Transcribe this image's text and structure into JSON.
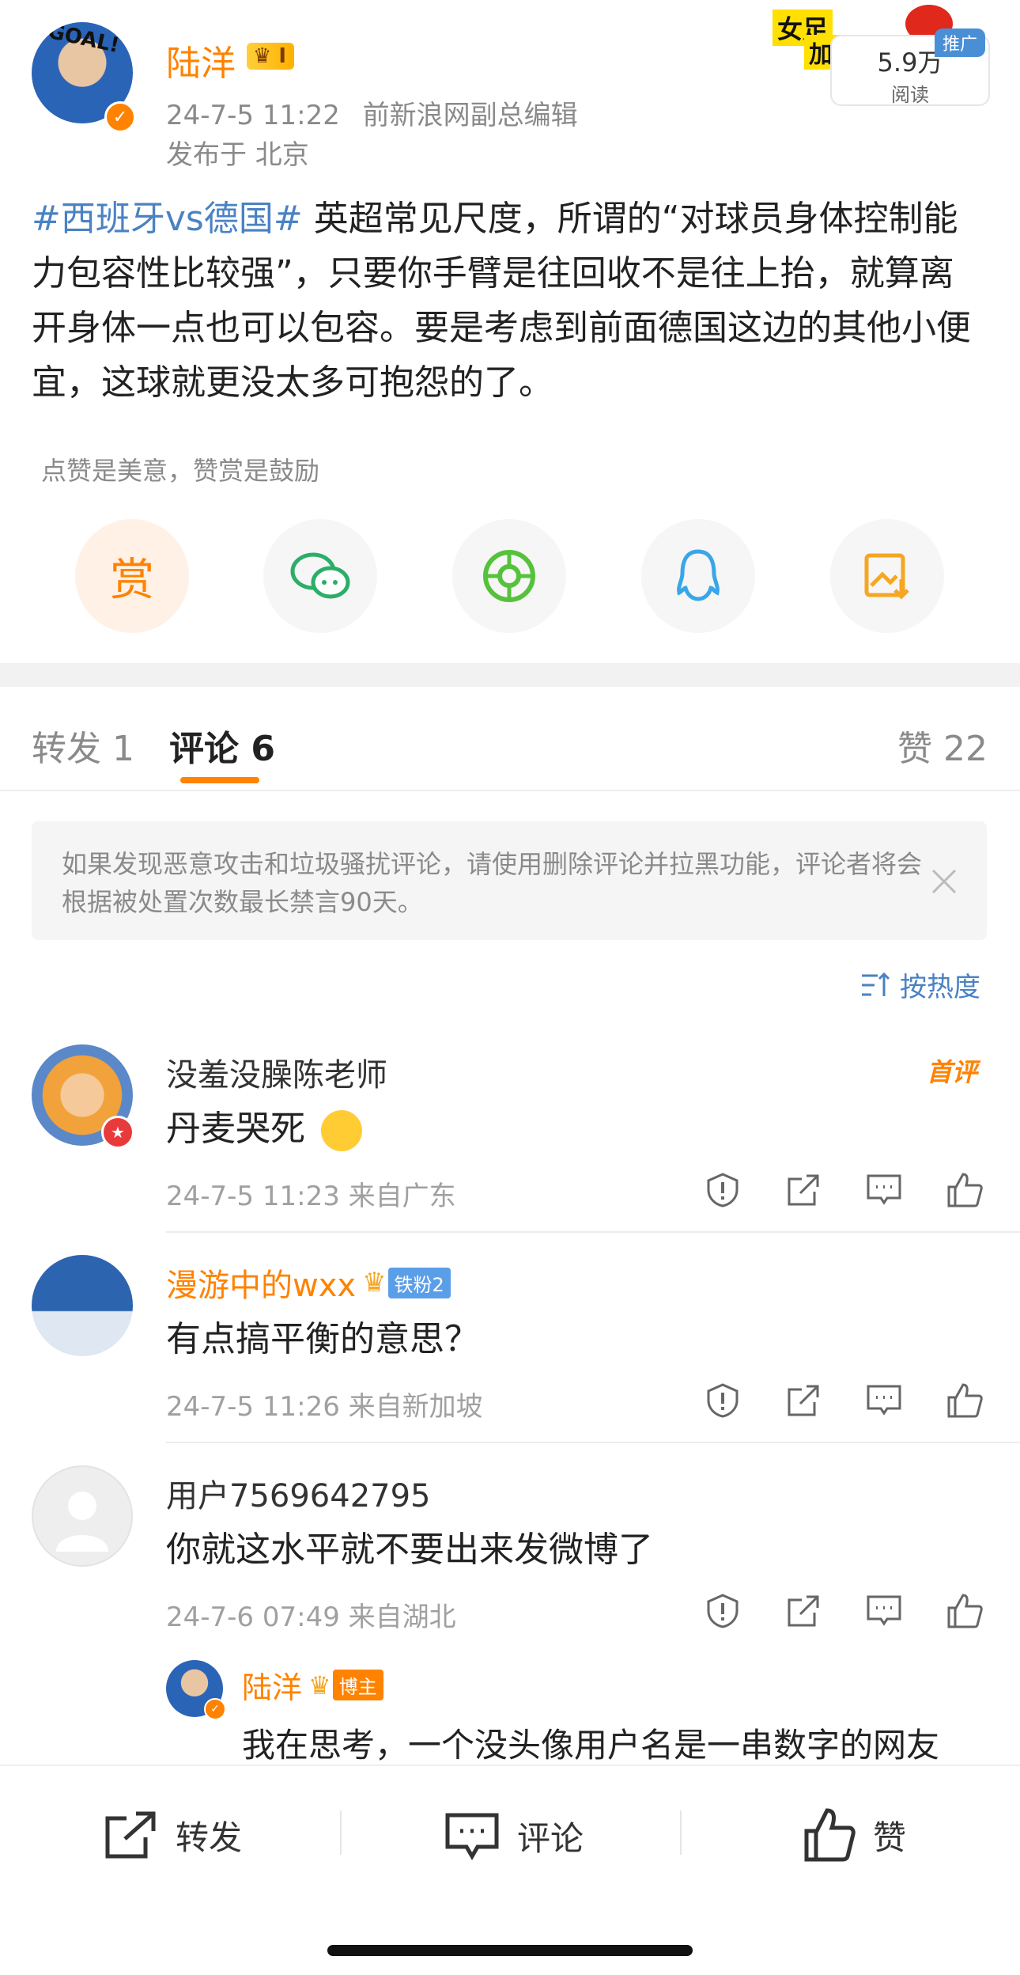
{
  "post": {
    "author": "陆洋",
    "timestamp": "24-7-5 11:22",
    "author_desc": "前新浪网副总编辑",
    "location": "发布于 北京",
    "hashtag": "#西班牙vs德国#",
    "body": "英超常见尺度，所谓的“对球员身体控制能力包容性比较强”，只要你手臂是往回收不是往上抬，就算离开身体一点也可以包容。要是考虑到前面德国这边的其他小便宜，这球就更没太多可抱怨的了。",
    "read_count": "5.9万",
    "read_label": "阅读",
    "promo_tag": "推广",
    "avatar_text": "GOAL!",
    "banner_text_1": "女足",
    "banner_text_2": "加油"
  },
  "reward": {
    "tagline": "点赞是美意，赞赏是鼓励",
    "reward_label": "赏"
  },
  "tabs": {
    "repost": "转发 1",
    "comment": "评论 6",
    "like": "赞 22"
  },
  "notice": {
    "text": "如果发现恶意攻击和垃圾骚扰评论，请使用删除评论并拉黑功能，评论者将会根据被处置次数最长禁言90天。"
  },
  "sort": {
    "label": "按热度"
  },
  "comments": [
    {
      "name": "没羞没臊陈老师",
      "text": "丹麦哭死",
      "meta": "24-7-5 11:23 来自广东",
      "tag": "首评"
    },
    {
      "name": "漫游中的wxx",
      "text": "有点搞平衡的意思？",
      "meta": "24-7-5 11:26 来自新加坡",
      "fan_badge": "铁粉2"
    },
    {
      "name": "用户7569642795",
      "text": "你就这水平就不要出来发微博了",
      "meta": "24-7-6 07:49 来自湖北"
    }
  ],
  "reply": {
    "name": "陆洋",
    "badge": "博主",
    "text": "我在思考，一个没头像用户名是一串数字的网友"
  },
  "bottom_bar": {
    "repost": "转发",
    "comment": "评论",
    "like": "赞"
  },
  "colors": {
    "accent": "#ff8200",
    "link": "#4a82c3",
    "fan_badge": "#5a9ee8"
  }
}
